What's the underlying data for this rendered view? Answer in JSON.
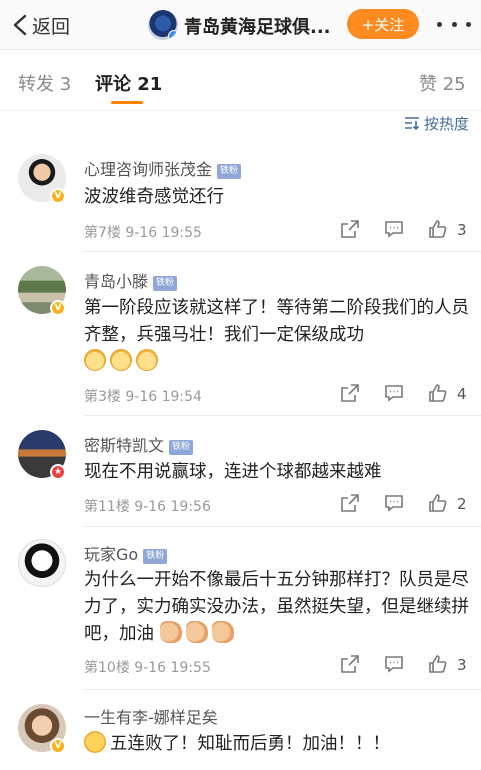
{
  "nav": {
    "back_label": "返回",
    "title": "青岛黄海足球俱...",
    "follow_label": "+关注"
  },
  "tabs": [
    {
      "label": "转发 3"
    },
    {
      "label": "评论 21"
    },
    {
      "label": "赞 25"
    }
  ],
  "sort_label": "按热度",
  "fan_badge_label": "铁粉",
  "comments": [
    {
      "username": "心理咨询师张茂金",
      "text": "波波维奇感觉还行",
      "floor": "第7楼",
      "time": "9-16 19:55",
      "likes": "3"
    },
    {
      "username": "青岛小滕",
      "text": "第一阶段应该就这样了！等待第二阶段我们的人员齐整，兵强马壮！我们一定保级成功",
      "floor": "第3楼",
      "time": "9-16 19:54",
      "likes": "4"
    },
    {
      "username": "密斯特凯文",
      "text": "现在不用说赢球，连进个球都越来越难",
      "floor": "第11楼",
      "time": "9-16 19:56",
      "likes": "2"
    },
    {
      "username": "玩家Go",
      "text": "为什么一开始不像最后十五分钟那样打？队员是尽力了，实力确实没办法，虽然挺失望，但是继续拼吧，加油",
      "floor": "第10楼",
      "time": "9-16 19:55",
      "likes": "3"
    },
    {
      "username": "一生有李-娜样足矣",
      "text": "五连败了！知耻而后勇！加油！！！"
    }
  ],
  "colors": {
    "accent_orange": "#ff8a20",
    "link_blue": "#486d9d",
    "verified_gold": "#f7b21c"
  }
}
